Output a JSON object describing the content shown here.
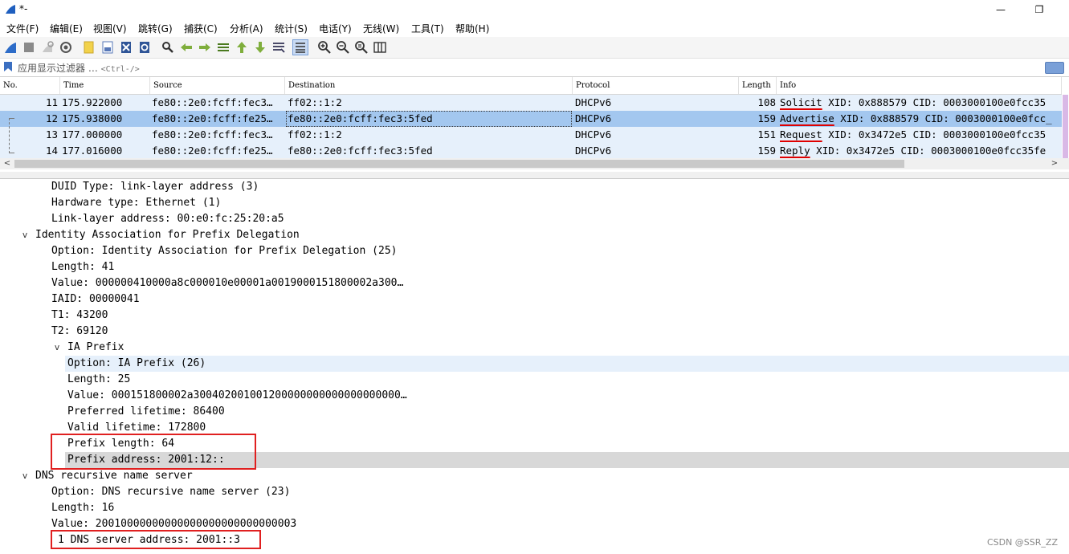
{
  "window": {
    "title": "*-",
    "minimize_glyph": "—",
    "restore_glyph": "❐"
  },
  "menu": [
    "文件(F)",
    "编辑(E)",
    "视图(V)",
    "跳转(G)",
    "捕获(C)",
    "分析(A)",
    "统计(S)",
    "电话(Y)",
    "无线(W)",
    "工具(T)",
    "帮助(H)"
  ],
  "toolbar": {
    "icons": [
      "shark-fin-start-icon",
      "stop-capture-icon",
      "restart-capture-icon",
      "capture-options-icon",
      "open-file-icon",
      "save-file-icon",
      "close-file-icon",
      "reload-file-icon",
      "find-packet-icon",
      "go-back-icon",
      "go-forward-icon",
      "go-to-packet-icon",
      "first-packet-icon",
      "last-packet-icon",
      "autoscroll-icon",
      "colorize-icon",
      "zoom-in-icon",
      "zoom-out-icon",
      "zoom-normal-icon",
      "resize-columns-icon"
    ]
  },
  "filter": {
    "placeholder": "应用显示过滤器 …",
    "shortcut": "<Ctrl-/>"
  },
  "packet_list": {
    "columns": [
      "No.",
      "Time",
      "Source",
      "Destination",
      "Protocol",
      "Length",
      "Info"
    ],
    "rows": [
      {
        "no": "11",
        "time": "175.922000",
        "source": "fe80::2e0:fcff:fec3…",
        "destination": "ff02::1:2",
        "protocol": "DHCPv6",
        "length": "108",
        "info_kw": "Solicit",
        "info_rest": " XID: 0x888579 CID: 0003000100e0fcc35",
        "selected": false
      },
      {
        "no": "12",
        "time": "175.938000",
        "source": "fe80::2e0:fcff:fe25…",
        "destination": "fe80::2e0:fcff:fec3:5fed",
        "protocol": "DHCPv6",
        "length": "159",
        "info_kw": "Advertise",
        "info_rest": " XID: 0x888579 CID: 0003000100e0fcc_",
        "selected": true
      },
      {
        "no": "13",
        "time": "177.000000",
        "source": "fe80::2e0:fcff:fec3…",
        "destination": "ff02::1:2",
        "protocol": "DHCPv6",
        "length": "151",
        "info_kw": "Request",
        "info_rest": " XID: 0x3472e5 CID: 0003000100e0fcc35",
        "selected": false
      },
      {
        "no": "14",
        "time": "177.016000",
        "source": "fe80::2e0:fcff:fe25…",
        "destination": "fe80::2e0:fcff:fec3:5fed",
        "protocol": "DHCPv6",
        "length": "159",
        "info_kw": "Reply",
        "info_rest": " XID: 0x3472e5 CID: 0003000100e0fcc35fe",
        "selected": false
      }
    ]
  },
  "detail": {
    "expand_glyph": "v",
    "lines": [
      "DUID Type: link-layer address (3)",
      "Hardware type: Ethernet (1)",
      "Link-layer address: 00:e0:fc:25:20:a5",
      "Identity Association for Prefix Delegation",
      "Option: Identity Association for Prefix Delegation (25)",
      "Length: 41",
      "Value: 000000410000a8c000010e00001a0019000151800002a300…",
      "IAID: 00000041",
      "T1: 43200",
      "T2: 69120",
      "IA Prefix",
      "Option: IA Prefix (26)",
      "Length: 25",
      "Value: 000151800002a300402001001200000000000000000000…",
      "Preferred lifetime: 86400",
      "Valid lifetime: 172800",
      "Prefix length: 64",
      "Prefix address: 2001:12::",
      "DNS recursive name server",
      "Option: DNS recursive name server (23)",
      "Length: 16",
      "Value: 20010000000000000000000000000003",
      "1 DNS server address: 2001::3"
    ]
  },
  "watermark": "CSDN @SSR_ZZ",
  "colors": {
    "row_bg": "#e6f0fb",
    "row_selected": "#a3c7ef",
    "annotation_red": "#e02020"
  }
}
